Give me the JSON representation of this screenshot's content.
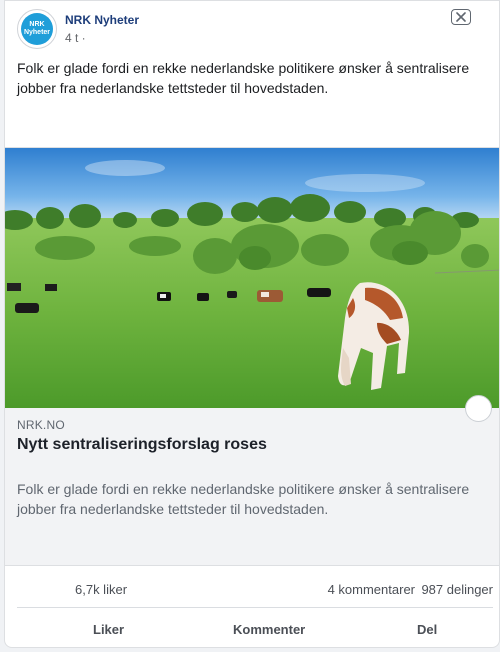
{
  "post": {
    "page_name": "NRK Nyheter",
    "avatar_text_1": "NRK",
    "avatar_text_2": "Nyheter",
    "time": "4 t ·",
    "text": "Folk er glade fordi en rekke nederlandske politikere ønsker å sentralisere jobber fra nederlandske tettsteder til hovedstaden."
  },
  "link": {
    "source": "NRK.NO",
    "title": "Nytt sentraliseringsforslag roses",
    "description": "Folk er glade fordi en rekke nederlandske politikere ønsker å sentralisere jobber fra nederlandske tettsteder til hovedstaden."
  },
  "stats": {
    "likes": "6,7k liker",
    "comments": "4 kommentarer",
    "shares": "987 delinger"
  },
  "actions": {
    "like": "Liker",
    "comment": "Kommenter",
    "share": "Del"
  },
  "icons": {
    "close": "close-icon",
    "more": "more-circle-icon"
  },
  "colors": {
    "brand": "#1f9ed9",
    "page_name": "#1d3d7a",
    "preview_bg": "#f2f3f5"
  }
}
